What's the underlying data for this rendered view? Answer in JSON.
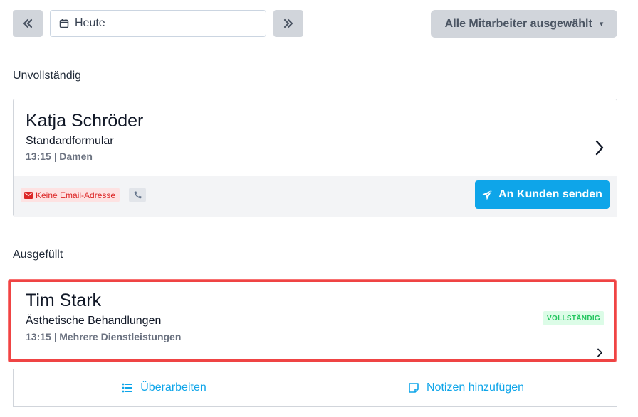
{
  "toolbar": {
    "prev_icon": "double-chevron-left-icon",
    "date_value": "Heute",
    "calendar_icon": "calendar-icon",
    "next_icon": "double-chevron-right-icon",
    "staff_select": "Alle Mitarbeiter ausgewählt",
    "staff_caret": "▾"
  },
  "sections": {
    "incomplete_title": "Unvollständig",
    "complete_title": "Ausgefüllt"
  },
  "incomplete_card": {
    "name": "Katja Schröder",
    "form": "Standardformular",
    "time": "13:15",
    "separator": "|",
    "service": "Damen",
    "no_email_label": "Keine Email-Adresse",
    "send_button": "An Kunden senden"
  },
  "complete_card": {
    "name": "Tim Stark",
    "form": "Ästhetische Behandlungen",
    "time": "13:15",
    "separator": "|",
    "service": "Mehrere Dienstleistungen",
    "status": "VOLLSTÄNDIG"
  },
  "actions": {
    "edit": "Überarbeiten",
    "notes": "Notizen hinzufügen"
  },
  "colors": {
    "accent": "#0ea5e9",
    "highlight_border": "#ef4444",
    "status_green": "#22c55e",
    "error_red": "#dc2626"
  }
}
